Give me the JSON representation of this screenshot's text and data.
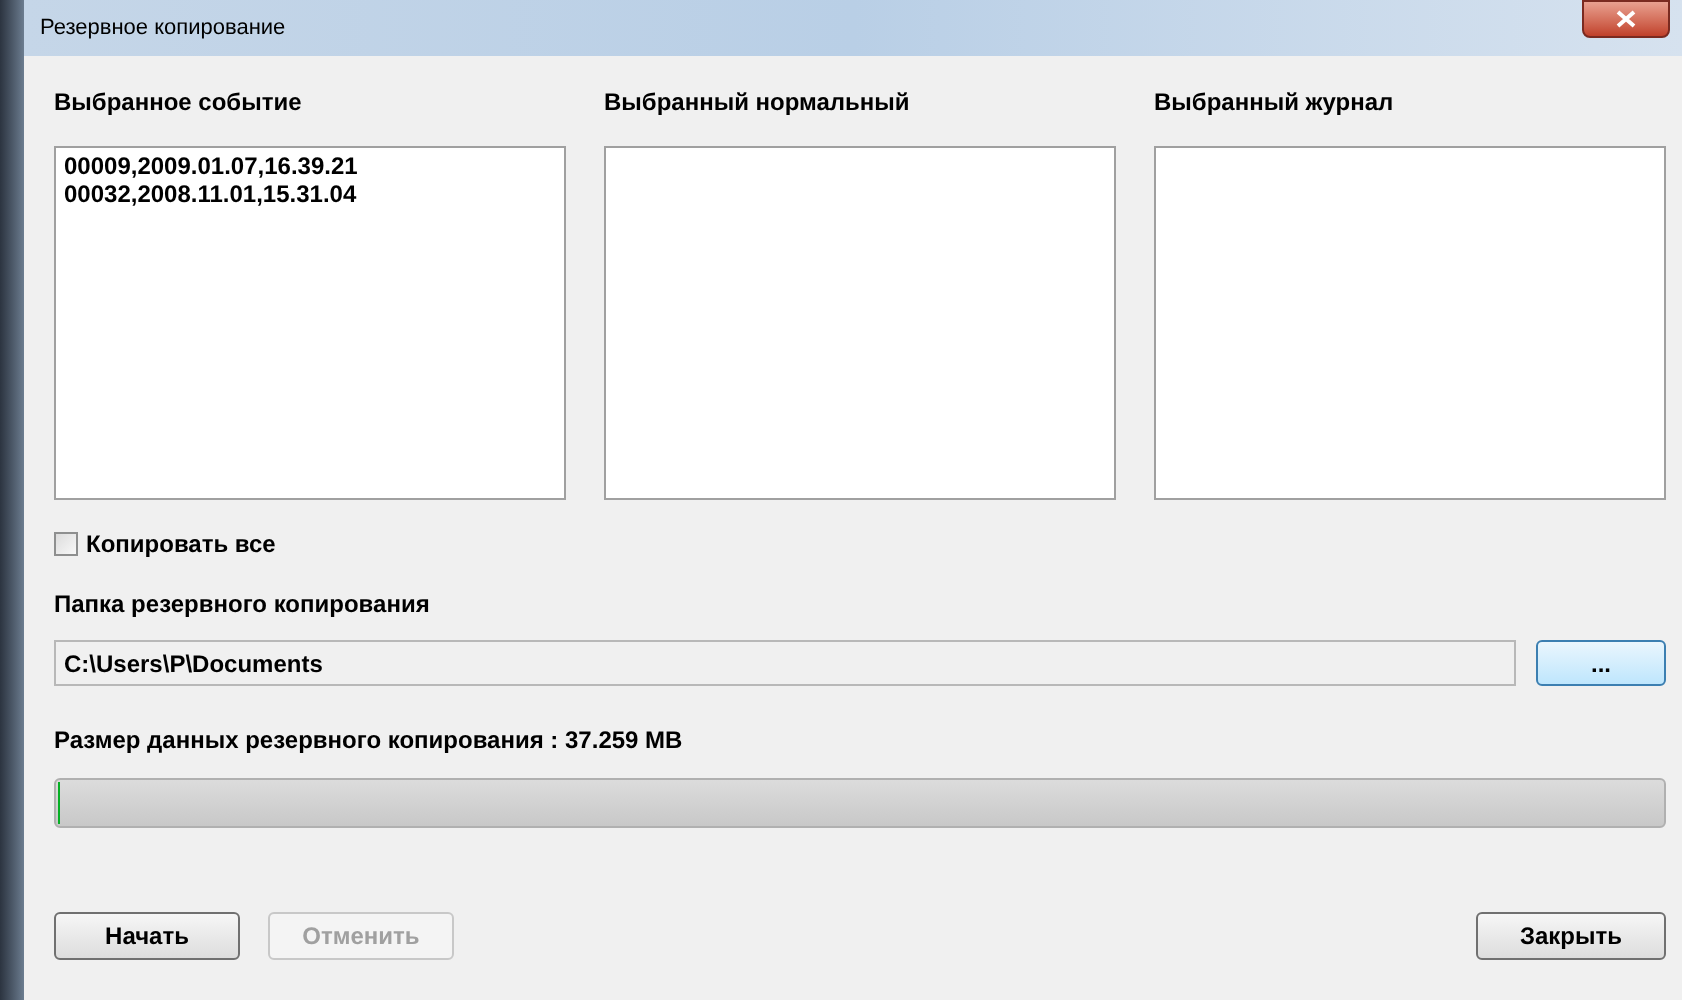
{
  "window": {
    "title": "Резервное копирование"
  },
  "lists": [
    {
      "heading": "Выбранное событие",
      "items": [
        "00009,2009.01.07,16.39.21",
        "00032,2008.11.01,15.31.04"
      ]
    },
    {
      "heading": "Выбранный нормальный"
    },
    {
      "heading": "Выбранный журнал"
    }
  ],
  "copy_all": {
    "label": "Копировать все",
    "checked": false
  },
  "folder": {
    "label": "Папка резервного копирования",
    "value": "C:\\Users\\P\\Documents",
    "browse": "..."
  },
  "size_label": "Размер данных резервного копирования : 37.259 MB",
  "progress": {
    "level": 0
  },
  "buttons": [
    {
      "label": "Начать",
      "disabled": false
    },
    {
      "label": "Отменить",
      "disabled": true
    }
  ],
  "close_button": "Закрыть"
}
